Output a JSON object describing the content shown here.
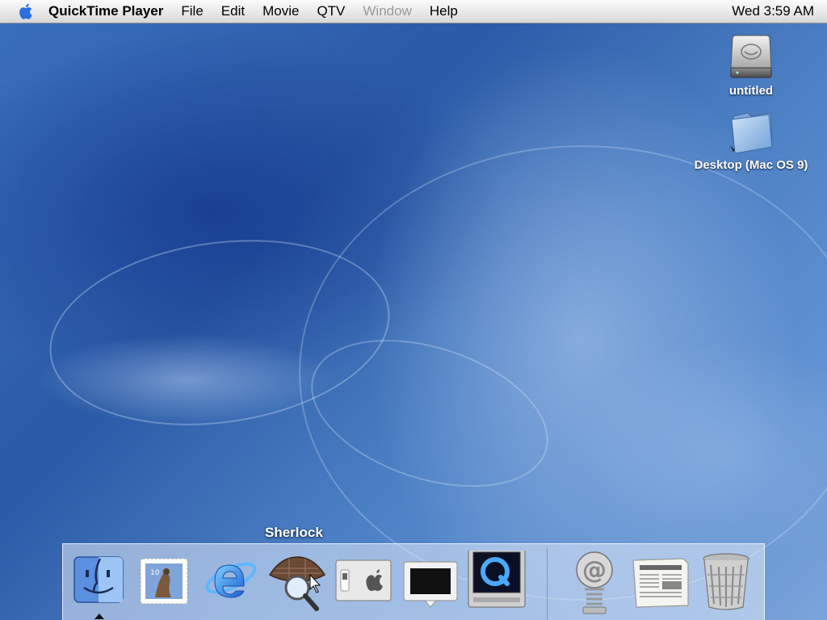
{
  "menubar": {
    "app_name": "QuickTime Player",
    "menus": [
      "File",
      "Edit",
      "Movie",
      "QTV",
      "Window",
      "Help"
    ],
    "disabled_menus": [
      "Window"
    ],
    "clock": "Wed 3:59 AM"
  },
  "desktop": {
    "icons": [
      {
        "label": "untitled",
        "icon": "hard-drive-icon"
      },
      {
        "label": "Desktop (Mac OS 9)",
        "icon": "folder-icon"
      }
    ]
  },
  "dock": {
    "tooltip": "Sherlock",
    "items": [
      {
        "name": "finder",
        "icon": "finder-icon",
        "running": true
      },
      {
        "name": "mail",
        "icon": "mail-stamp-icon"
      },
      {
        "name": "internet-explorer",
        "icon": "internet-explorer-icon"
      },
      {
        "name": "sherlock",
        "icon": "sherlock-hat-icon"
      },
      {
        "name": "system-preferences",
        "icon": "system-preferences-icon"
      },
      {
        "name": "display",
        "icon": "display-icon"
      },
      {
        "name": "quicktime",
        "icon": "quicktime-icon"
      },
      {
        "name": "internet-connect",
        "icon": "at-sign-icon"
      },
      {
        "name": "news",
        "icon": "newspaper-icon"
      },
      {
        "name": "trash",
        "icon": "trash-icon"
      }
    ]
  },
  "colors": {
    "desktop_blue": "#2f5fa6",
    "menubar": "#e7e7e7",
    "disabled_text": "#9a9a9a"
  }
}
